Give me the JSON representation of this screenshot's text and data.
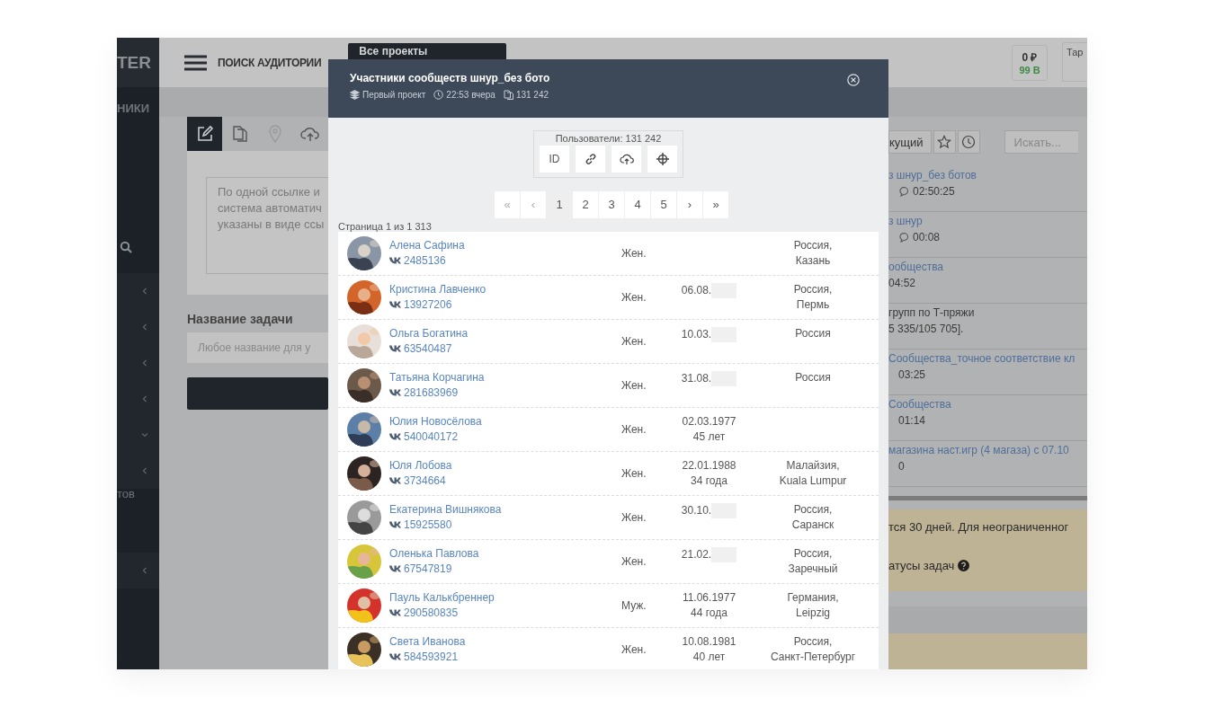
{
  "sidebar": {
    "logo": "TER",
    "section": "НИКИ",
    "items": [
      {
        "kind": "search"
      },
      {
        "kind": "chevron",
        "expanded": false
      },
      {
        "kind": "chevron",
        "expanded": false
      },
      {
        "kind": "chevron",
        "expanded": false
      },
      {
        "kind": "chevron",
        "expanded": false
      },
      {
        "kind": "chevron",
        "expanded": true
      },
      {
        "kind": "chevron",
        "expanded": false
      },
      {
        "kind": "text",
        "label": "тов"
      },
      {
        "kind": "chevron",
        "expanded": false
      }
    ]
  },
  "header": {
    "title": "ПОИСК АУДИТОРИИ",
    "project_select": "Все проекты",
    "balance": "0 ₽",
    "bonus": "99 В",
    "tariff": "Тар"
  },
  "left_panel": {
    "tabs": [
      {
        "selected": true,
        "disabled": false
      },
      {
        "selected": false,
        "disabled": false
      },
      {
        "selected": false,
        "disabled": true
      },
      {
        "selected": false,
        "disabled": false
      }
    ],
    "hint": [
      "По одной ссылке и",
      "система автоматич",
      "указаны в виде ссы"
    ],
    "task_name_label": "Название задачи",
    "task_name_placeholder": "Любое название для у"
  },
  "right_panel": {
    "filter": "кущий",
    "search_placeholder": "Искать...",
    "tasks": [
      {
        "kind": "link",
        "title": "з шнур_без ботов",
        "time": "02:50:25",
        "icon": true
      },
      {
        "kind": "link",
        "title": "з шнур",
        "time": "00:08",
        "icon": true
      },
      {
        "kind": "link",
        "title": "ообщества",
        "time": "04:52",
        "icon": false
      },
      {
        "kind": "plain",
        "title": "групп по Т-пряжи",
        "time": "5 335/105 705].",
        "icon": false
      },
      {
        "kind": "link",
        "title": "Сообщества_точное соответствие кл",
        "time": "03:25",
        "icon": false
      },
      {
        "kind": "link",
        "title": "Сообщества",
        "time": "01:14",
        "icon": false
      },
      {
        "kind": "link",
        "title": "магазина наст.игр (4 магаза) с 07.10",
        "time": "0",
        "icon": false
      }
    ],
    "notice": [
      "тся 30 дней. Для неограниченног",
      "атусы задач"
    ]
  },
  "modal": {
    "title": "Участники сообществ шнур_без бото",
    "project": "Первый проект",
    "time": "22:53 вчера",
    "count": "131 242",
    "users_label": "Пользователи: 131 242",
    "tools": [
      {
        "kind": "text",
        "label": "ID"
      },
      {
        "kind": "link"
      },
      {
        "kind": "upload"
      },
      {
        "kind": "target"
      }
    ],
    "pages": [
      {
        "label": "«",
        "selected": false,
        "disabled": true
      },
      {
        "label": "‹",
        "selected": false,
        "disabled": true
      },
      {
        "label": "1",
        "selected": true,
        "disabled": false
      },
      {
        "label": "2",
        "selected": false,
        "disabled": false
      },
      {
        "label": "3",
        "selected": false,
        "disabled": false
      },
      {
        "label": "4",
        "selected": false,
        "disabled": false
      },
      {
        "label": "5",
        "selected": false,
        "disabled": false
      },
      {
        "label": "›",
        "selected": false,
        "disabled": false
      },
      {
        "label": "»",
        "selected": false,
        "disabled": false
      }
    ],
    "page_info": "Страница 1 из 1 313",
    "rows": [
      {
        "name": "Алена Сафина",
        "id": "2485136",
        "gender": "Жен.",
        "date": "",
        "year_hidden": false,
        "age": "",
        "location": [
          "Россия,",
          "Казань"
        ]
      },
      {
        "name": "Кристина Лавченко",
        "id": "13927206",
        "gender": "Жен.",
        "date": "06.08.",
        "year_hidden": true,
        "age": "",
        "location": [
          "Россия,",
          "Пермь"
        ]
      },
      {
        "name": "Ольга Богатина",
        "id": "63540487",
        "gender": "Жен.",
        "date": "10.03.",
        "year_hidden": true,
        "age": "",
        "location": [
          "Россия"
        ]
      },
      {
        "name": "Татьяна Корчагина",
        "id": "281683969",
        "gender": "Жен.",
        "date": "31.08.",
        "year_hidden": true,
        "age": "",
        "location": [
          "Россия"
        ]
      },
      {
        "name": "Юлия Новосёлова",
        "id": "540040172",
        "gender": "Жен.",
        "date": "02.03.1977",
        "year_hidden": false,
        "age": "45 лет",
        "location": []
      },
      {
        "name": "Юля Лобова",
        "id": "3734664",
        "gender": "Жен.",
        "date": "22.01.1988",
        "year_hidden": false,
        "age": "34 года",
        "location": [
          "Малайзия,",
          "Kuala Lumpur"
        ]
      },
      {
        "name": "Екатерина Вишнякова",
        "id": "15925580",
        "gender": "Жен.",
        "date": "30.10.",
        "year_hidden": true,
        "age": "",
        "location": [
          "Россия,",
          "Саранск"
        ]
      },
      {
        "name": "Оленька Павлова",
        "id": "67547819",
        "gender": "Жен.",
        "date": "21.02.",
        "year_hidden": true,
        "age": "",
        "location": [
          "Россия,",
          "Заречный"
        ]
      },
      {
        "name": "Пауль Калькбреннер",
        "id": "290580835",
        "gender": "Муж.",
        "date": "11.06.1977",
        "year_hidden": false,
        "age": "44 года",
        "location": [
          "Германия,",
          "Leipzig"
        ]
      },
      {
        "name": "Света Иванова",
        "id": "584593921",
        "gender": "Жен.",
        "date": "10.08.1981",
        "year_hidden": false,
        "age": "40 лет",
        "location": [
          "Россия,",
          "Санкт-Петербург"
        ]
      }
    ]
  }
}
